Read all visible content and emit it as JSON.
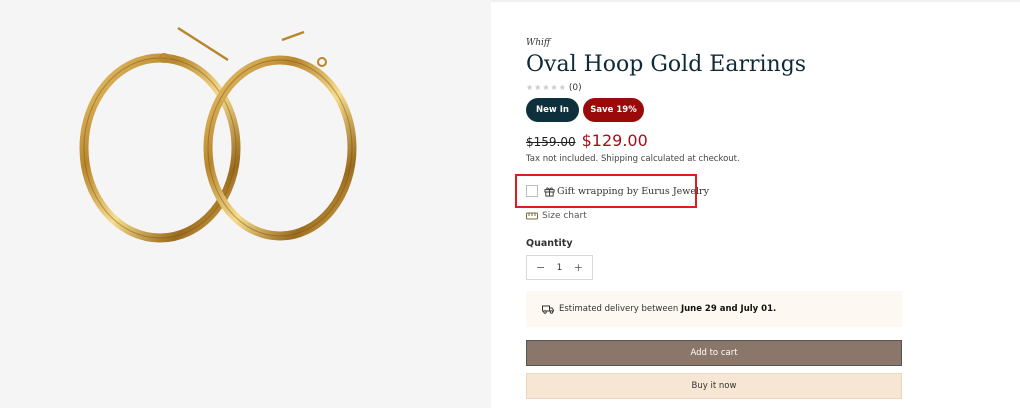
{
  "product": {
    "image_alt": "Oval Hoop Gold Earrings",
    "vendor": "Whiff",
    "title": "Oval Hoop Gold Earrings",
    "rating_count": "(0)",
    "badges": {
      "new": "New In",
      "save": "Save 19%"
    },
    "price_compare": "$159.00",
    "price_sale": "$129.00",
    "tax_note": "Tax not included. Shipping calculated at checkout.",
    "gift_label": "Gift wrapping by Eurus Jewelry",
    "size_chart": "Size chart",
    "quantity_label": "Quantity",
    "quantity_value": "1",
    "delivery_prefix": "Estimated delivery between ",
    "delivery_dates": "June 29 and July 01.",
    "add_to_cart": "Add to cart",
    "buy_now": "Buy it now"
  },
  "icons": {
    "gift": "gift-icon",
    "size_chart": "ruler-icon",
    "delivery": "truck-icon",
    "minus": "minus-icon",
    "plus": "plus-icon",
    "star": "star-icon"
  },
  "colors": {
    "badge_new": "#0e2f3c",
    "badge_save": "#9b0a0a",
    "sale_price": "#a3101a",
    "add_to_cart_bg": "#8a7769",
    "buy_now_bg": "#f7e6d4",
    "highlight_box": "#e11c1c"
  }
}
